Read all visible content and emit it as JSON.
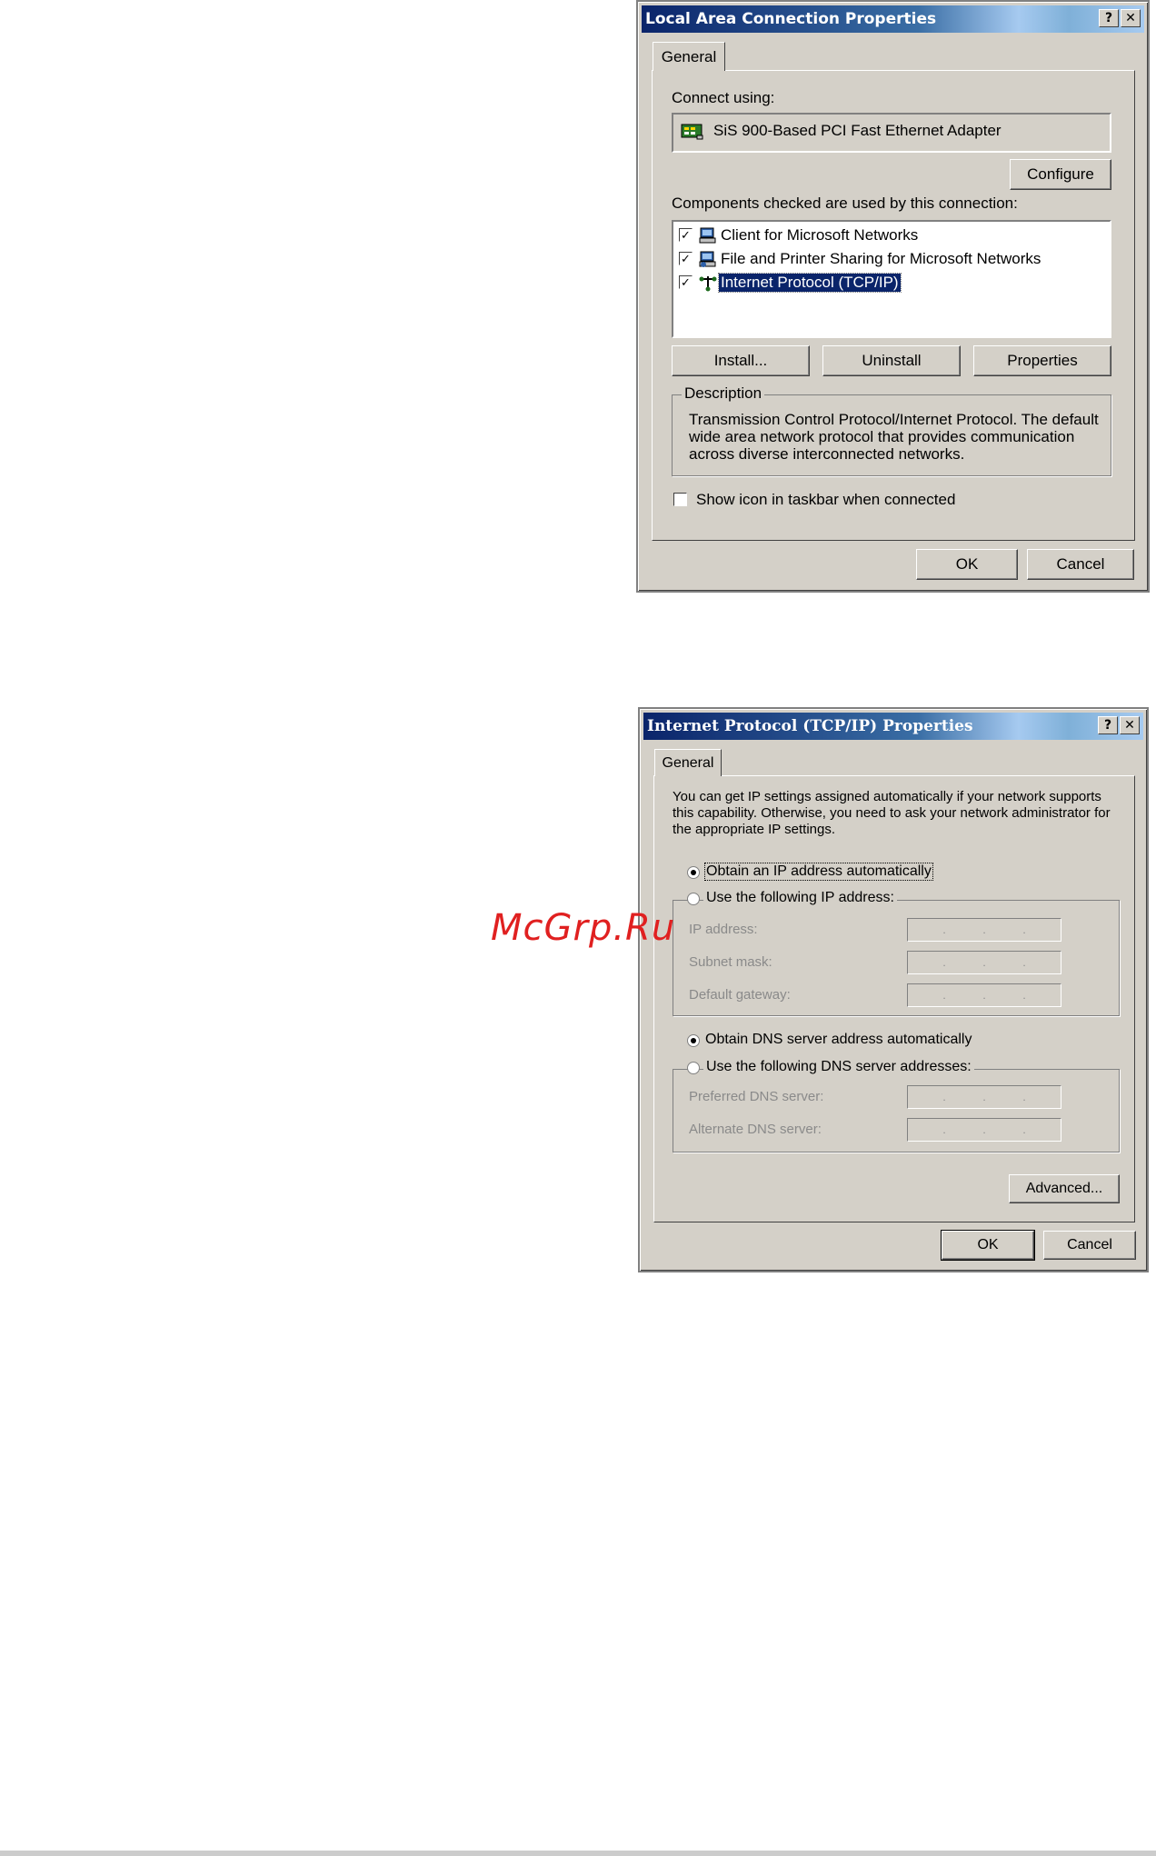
{
  "dialog1": {
    "title": "Local Area Connection Properties",
    "help_btn": "?",
    "close_btn": "✕",
    "tab": "General",
    "connect_using_label": "Connect using:",
    "adapter": "SiS 900-Based PCI Fast Ethernet Adapter",
    "configure_btn": "Configure",
    "components_label": "Components checked are used by this connection:",
    "components": [
      {
        "label": "Client for Microsoft Networks",
        "checked": true
      },
      {
        "label": "File and Printer Sharing for Microsoft Networks",
        "checked": true
      },
      {
        "label": "Internet Protocol (TCP/IP)",
        "checked": true,
        "selected": true
      }
    ],
    "install_btn": "Install...",
    "uninstall_btn": "Uninstall",
    "properties_btn": "Properties",
    "description_caption": "Description",
    "description_lines": [
      "Transmission Control Protocol/Internet Protocol. The default",
      "wide area network protocol that provides communication",
      "across diverse interconnected networks."
    ],
    "show_icon_label": "Show icon in taskbar when connected",
    "show_icon_checked": false,
    "ok_btn": "OK",
    "cancel_btn": "Cancel"
  },
  "dialog2": {
    "title": "Internet Protocol (TCP/IP) Properties",
    "help_btn": "?",
    "close_btn": "✕",
    "tab": "General",
    "intro_lines": [
      "You can get IP settings assigned automatically if your network supports",
      "this capability. Otherwise, you need to ask your network administrator for",
      "the appropriate IP settings."
    ],
    "obtain_ip_auto": "Obtain an IP address automatically",
    "use_following_ip": "Use the following IP address:",
    "ip_address_label": "IP address:",
    "subnet_mask_label": "Subnet mask:",
    "default_gateway_label": "Default gateway:",
    "obtain_dns_auto": "Obtain DNS server address automatically",
    "use_following_dns": "Use the following DNS server addresses:",
    "preferred_dns_label": "Preferred DNS server:",
    "alternate_dns_label": "Alternate DNS server:",
    "ip_dots": ".",
    "advanced_btn": "Advanced...",
    "ok_btn": "OK",
    "cancel_btn": "Cancel"
  },
  "watermark": "McGrp.Ru"
}
